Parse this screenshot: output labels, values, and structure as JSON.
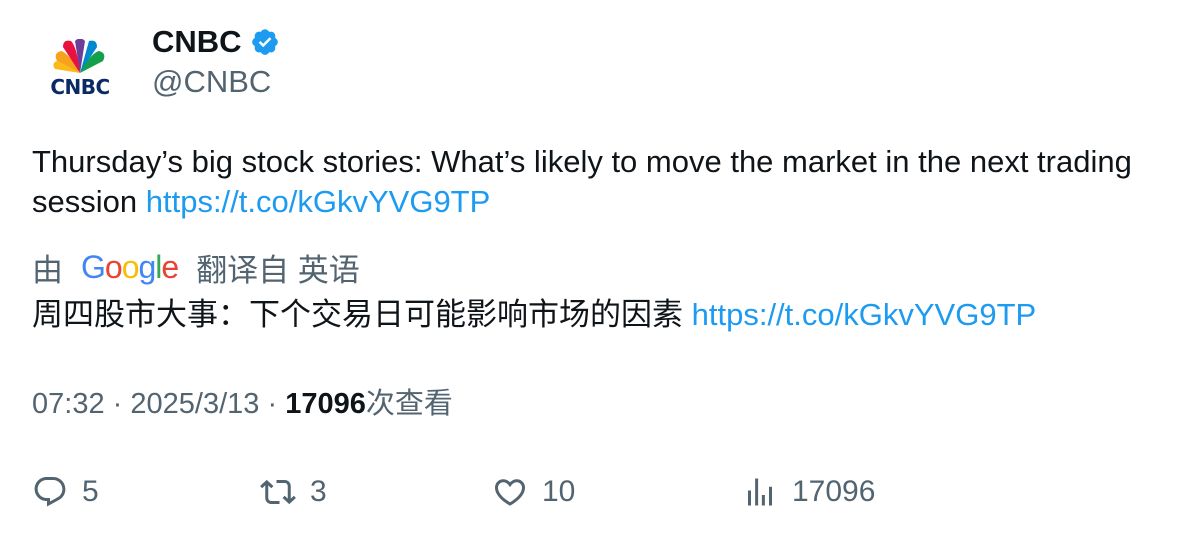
{
  "author": {
    "display_name": "CNBC",
    "handle": "@CNBC",
    "avatar_logo_text": "CNBC",
    "verified": true
  },
  "tweet": {
    "text": "Thursday’s big stock stories: What’s likely to move the market in the next trading session",
    "link": "https://t.co/kGkvYVG9TP"
  },
  "translation": {
    "prefix": "由",
    "provider_letters": [
      "G",
      "o",
      "o",
      "g",
      "l",
      "e"
    ],
    "suffix": "翻译自 英语",
    "text": "周四股市大事：下个交易日可能影响市场的因素",
    "link": "https://t.co/kGkvYVG9TP"
  },
  "meta": {
    "time": "07:32",
    "separator": "·",
    "date": "2025/3/13",
    "views_count": "17096",
    "views_label": "次查看"
  },
  "actions": {
    "reply_count": "5",
    "retweet_count": "3",
    "like_count": "10",
    "views_count": "17096"
  },
  "colors": {
    "link": "#1d9bf0",
    "secondary_text": "#536471",
    "primary_text": "#0f1419",
    "verified": "#1d9bf0"
  },
  "icons": {
    "reply": "reply-icon",
    "retweet": "retweet-icon",
    "like": "heart-icon",
    "views": "views-chart-icon",
    "verified": "verified-badge-icon"
  }
}
